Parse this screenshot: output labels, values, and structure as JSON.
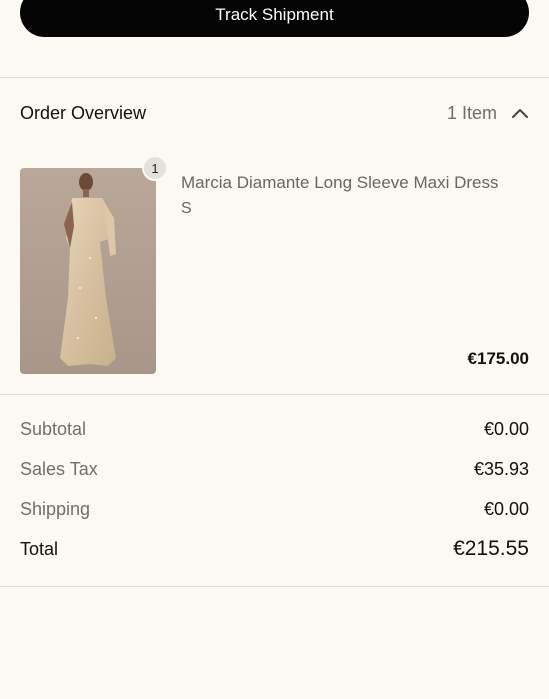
{
  "actions": {
    "track_label": "Track Shipment"
  },
  "overview": {
    "title": "Order Overview",
    "item_count": "1 Item",
    "toggle_icon": "chevron-up-icon"
  },
  "items": [
    {
      "quantity": "1",
      "name": "Marcia Diamante Long Sleeve Maxi Dress",
      "variant": "S",
      "price": "€175.00"
    }
  ],
  "summary": {
    "subtotal_label": "Subtotal",
    "subtotal_value": "€0.00",
    "tax_label": "Sales Tax",
    "tax_value": "€35.93",
    "shipping_label": "Shipping",
    "shipping_value": "€0.00",
    "total_label": "Total",
    "total_value": "€215.55"
  },
  "colors": {
    "background": "#fbf9f2",
    "button": "#050505",
    "muted_text": "#6f6f6f"
  }
}
